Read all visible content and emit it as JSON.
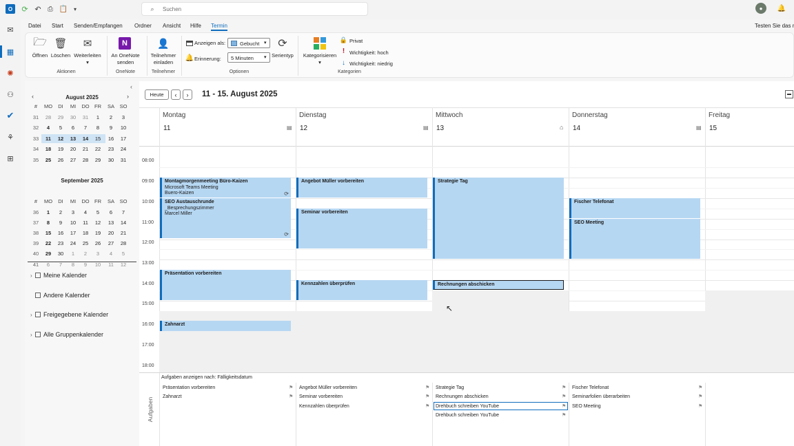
{
  "search": {
    "placeholder": "Suchen"
  },
  "titlebar": {
    "trial": "Testen Sie das n"
  },
  "menu": [
    "Datei",
    "Start",
    "Senden/Empfangen",
    "Ordner",
    "Ansicht",
    "Hilfe",
    "Termin"
  ],
  "ribbon": {
    "open": "Öffnen",
    "delete": "Löschen",
    "forward": "Weiterleiten",
    "onenote_1": "An OneNote",
    "onenote_2": "senden",
    "invite_1": "Teilnehmer",
    "invite_2": "einladen",
    "show_as_label": "Anzeigen als:",
    "show_as_value": "Gebucht",
    "reminder_label": "Erinnerung:",
    "reminder_value": "5 Minuten",
    "series": "Serientyp",
    "categorize": "Kategorisieren",
    "private": "Privat",
    "importance_high": "Wichtigkeit: hoch",
    "importance_low": "Wichtigkeit: niedrig",
    "groups": {
      "actions": "Aktionen",
      "onenote": "OneNote",
      "attendees": "Teilnehmer",
      "options": "Optionen",
      "categories": "Kategorien"
    }
  },
  "month1": {
    "title": "August 2025",
    "headers": [
      "#",
      "MO",
      "DI",
      "MI",
      "DO",
      "FR",
      "SA",
      "SO"
    ],
    "rows": [
      [
        "31",
        "28",
        "29",
        "30",
        "31",
        "1",
        "2",
        "3"
      ],
      [
        "32",
        "4",
        "5",
        "6",
        "7",
        "8",
        "9",
        "10"
      ],
      [
        "33",
        "11",
        "12",
        "13",
        "14",
        "15",
        "16",
        "17"
      ],
      [
        "34",
        "18",
        "19",
        "20",
        "21",
        "22",
        "23",
        "24"
      ],
      [
        "35",
        "25",
        "26",
        "27",
        "28",
        "29",
        "30",
        "31"
      ]
    ]
  },
  "month2": {
    "title": "September 2025",
    "headers": [
      "#",
      "MO",
      "DI",
      "MI",
      "DO",
      "FR",
      "SA",
      "SO"
    ],
    "rows": [
      [
        "36",
        "1",
        "2",
        "3",
        "4",
        "5",
        "6",
        "7"
      ],
      [
        "37",
        "8",
        "9",
        "10",
        "11",
        "12",
        "13",
        "14"
      ],
      [
        "38",
        "15",
        "16",
        "17",
        "18",
        "19",
        "20",
        "21"
      ],
      [
        "39",
        "22",
        "23",
        "24",
        "25",
        "26",
        "27",
        "28"
      ],
      [
        "40",
        "29",
        "30",
        "1",
        "2",
        "3",
        "4",
        "5"
      ],
      [
        "41",
        "6",
        "7",
        "8",
        "9",
        "10",
        "11",
        "12"
      ]
    ]
  },
  "calendars": [
    "Meine Kalender",
    "Andere Kalender",
    "Freigegebene Kalender",
    "Alle Gruppenkalender"
  ],
  "nav": {
    "today": "Heute",
    "range": "11 - 15. August 2025"
  },
  "days": [
    {
      "name": "Montag",
      "num": "11"
    },
    {
      "name": "Dienstag",
      "num": "12"
    },
    {
      "name": "Mittwoch",
      "num": "13"
    },
    {
      "name": "Donnerstag",
      "num": "14"
    },
    {
      "name": "Freitag",
      "num": "15"
    }
  ],
  "times": [
    "08:00",
    "09:00",
    "10:00",
    "11:00",
    "12:00",
    "13:00",
    "14:00",
    "15:00",
    "16:00",
    "17:00",
    "18:00"
  ],
  "events": [
    {
      "title": "Montagmorgenmeeting Büro-Kaizen",
      "sub1": "Microsoft Teams Meeting",
      "sub2": "Buero-Kaizen"
    },
    {
      "title": "SEO Austauschrunde",
      "sub1": "_Besprechungszimmer",
      "sub2": "Marcel Miller"
    },
    {
      "title": "Präsentation vorbereiten"
    },
    {
      "title": "Zahnarzt"
    },
    {
      "title": "Angebot Müller vorbereiten"
    },
    {
      "title": "Seminar vorbereiten"
    },
    {
      "title": "Kennzahlen überprüfen"
    },
    {
      "title": "Strategie Tag"
    },
    {
      "title": "Rechnungen abschicken"
    },
    {
      "title": "Fischer Telefonat"
    },
    {
      "title": "SEO Meeting"
    }
  ],
  "tasks": {
    "header": "Aufgaben anzeigen nach: Fälligkeitsdatum",
    "side": "Aufgaben",
    "mon": [
      "Präsentation vorbereiten",
      "Zahnarzt"
    ],
    "tue": [
      "Angebot Müller vorbereiten",
      "Seminar vorbereiten",
      "Kennzahlen überprüfen"
    ],
    "wed": [
      "Strategie Tag",
      "Rechnungen abschicken",
      "Drehbuch schreiben YouTube",
      "Drehbuch schreiben YouTube"
    ],
    "thu": [
      "Fischer Telefonat",
      "Seminarfolien überarbeiten",
      "SEO Meeting"
    ]
  }
}
